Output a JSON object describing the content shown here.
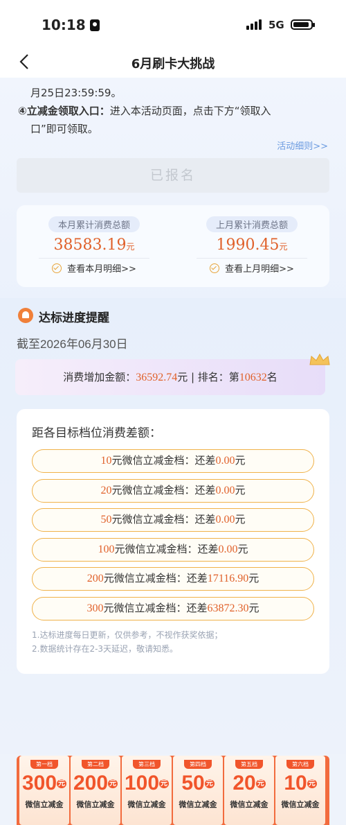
{
  "status": {
    "time": "10:18",
    "network": "5G"
  },
  "nav": {
    "title": "6月刷卡大挑战"
  },
  "rules": {
    "line1": "月25日23:59:59。",
    "line2_bold": "④立减金领取入口：",
    "line2_rest": "进入本活动页面，点击下方“领取入",
    "line3": "口”即可领取。",
    "link": "活动细则>>"
  },
  "signup_button": "已报名",
  "spend": {
    "this_month_label": "本月累计消费总额",
    "this_month_amount": "38583.19",
    "last_month_label": "上月累计消费总额",
    "last_month_amount": "1990.45",
    "currency": "元",
    "this_month_link": "查看本月明细>>",
    "last_month_link": "查看上月明细>>"
  },
  "progress": {
    "title": "达标进度提醒",
    "as_of": "截至2026年06月30日",
    "increase_label": "消费增加金额：",
    "increase_amount": "36592.74",
    "rank_label": "元 | 排名：第",
    "rank_value": "10632",
    "rank_suffix": "名"
  },
  "targets": {
    "title": "距各目标档位消费差额：",
    "tiers": [
      {
        "amount": "10",
        "label": "元微信立减金档：还差",
        "gap": "0.00",
        "unit": "元"
      },
      {
        "amount": "20",
        "label": "元微信立减金档：还差",
        "gap": "0.00",
        "unit": "元"
      },
      {
        "amount": "50",
        "label": "元微信立减金档：还差",
        "gap": "0.00",
        "unit": "元"
      },
      {
        "amount": "100",
        "label": "元微信立减金档：还差",
        "gap": "0.00",
        "unit": "元"
      },
      {
        "amount": "200",
        "label": "元微信立减金档：还差",
        "gap": "17116.90",
        "unit": "元"
      },
      {
        "amount": "300",
        "label": "元微信立减金档：还差",
        "gap": "63872.30",
        "unit": "元"
      }
    ],
    "note1": "1.达标进度每日更新，仅供参考，不视作获奖依据；",
    "note2": "2.数据统计存在2-3天延迟，敬请知悉。"
  },
  "coupons": [
    {
      "tag": "第一档",
      "amount": "300",
      "name": "微信立减金"
    },
    {
      "tag": "第二档",
      "amount": "200",
      "name": "微信立减金"
    },
    {
      "tag": "第三档",
      "amount": "100",
      "name": "微信立减金"
    },
    {
      "tag": "第四档",
      "amount": "50",
      "name": "微信立减金"
    },
    {
      "tag": "第五档",
      "amount": "20",
      "name": "微信立减金"
    },
    {
      "tag": "第六档",
      "amount": "10",
      "name": "微信立减金"
    }
  ],
  "colors": {
    "accent": "#e0612a",
    "tier_border": "#f0b24a",
    "link": "#6b9be0"
  }
}
